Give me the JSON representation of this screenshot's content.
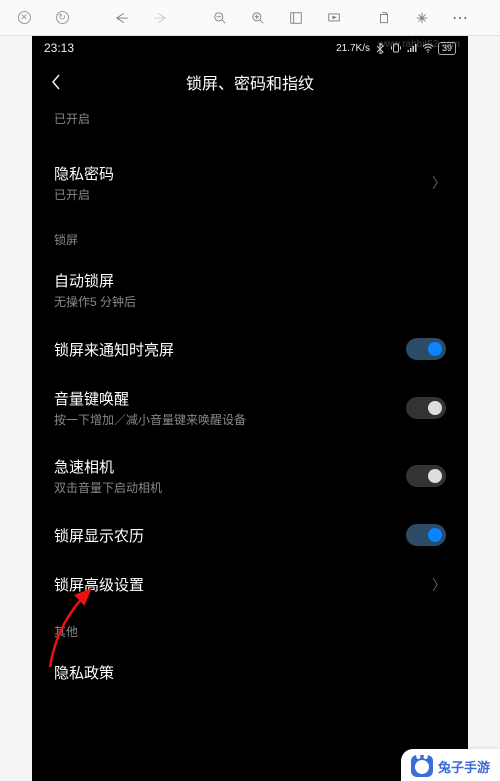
{
  "status": {
    "time": "23:13",
    "net_speed": "21.7K/s",
    "battery": "39"
  },
  "header": {
    "title": "锁屏、密码和指纹"
  },
  "top": {
    "enabled": "已开启"
  },
  "rows": {
    "privacy_pw": {
      "title": "隐私密码",
      "sub": "已开启"
    },
    "auto_lock": {
      "title": "自动锁屏",
      "sub": "无操作5 分钟后"
    },
    "notif_wake": {
      "title": "锁屏来通知时亮屏",
      "on": true
    },
    "vol_wake": {
      "title": "音量键唤醒",
      "sub": "按一下增加／减小音量键来唤醒设备",
      "on": false
    },
    "quick_cam": {
      "title": "急速相机",
      "sub": "双击音量下启动相机",
      "on": false
    },
    "lunar": {
      "title": "锁屏显示农历",
      "on": true
    },
    "advanced": {
      "title": "锁屏高级设置"
    },
    "privacy_policy": {
      "title": "隐私政策"
    }
  },
  "sections": {
    "lock": "锁屏",
    "other": "其他"
  },
  "watermark": "www.rabbit52.com",
  "footer": "兔子手游"
}
